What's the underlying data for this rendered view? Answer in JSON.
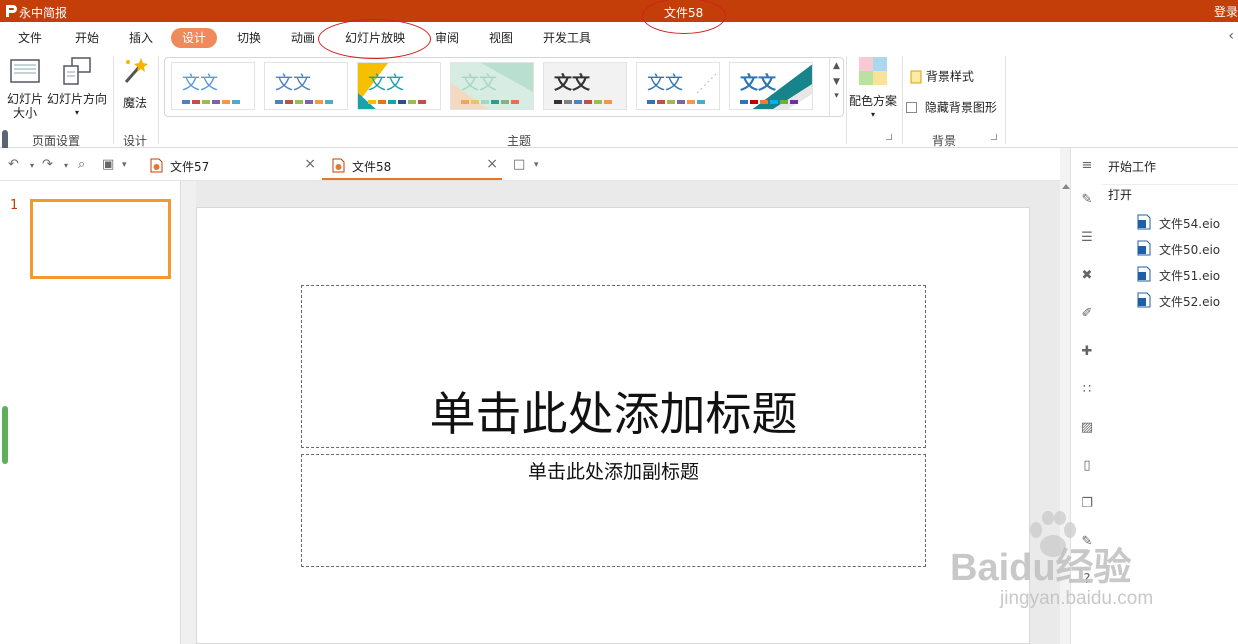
{
  "app": {
    "name": "永中简报",
    "document_title": "文件58",
    "login": "登录"
  },
  "menu": [
    "文件",
    "开始",
    "插入",
    "设计",
    "切换",
    "动画",
    "幻灯片放映",
    "审阅",
    "视图",
    "开发工具"
  ],
  "menu_active": "设计",
  "ribbon": {
    "slide_size": "幻灯片\n大小",
    "slide_orientation": "幻灯片方向",
    "magic": "魔法",
    "group_page_setup": "页面设置",
    "group_design": "设计",
    "group_theme": "主题",
    "color_scheme": "配色方案",
    "background_style": "背景样式",
    "hide_background": "隐藏背景图形",
    "group_background": "背景",
    "theme_glyph": "文文",
    "themes": [
      {
        "first": "#5b9bd5",
        "second": "#5b9bd5",
        "bars": [
          "#4f81bd",
          "#c0504d",
          "#9bbb59",
          "#8064a2",
          "#f79646",
          "#4bacc6"
        ]
      },
      {
        "first": "#4f81bd",
        "second": "#4f81bd",
        "bars": [
          "#4f81bd",
          "#c0504d",
          "#9bbb59",
          "#8064a2",
          "#f79646",
          "#4bacc6"
        ]
      },
      {
        "first": "#1ba2a8",
        "second": "#1ba2a8",
        "bars": [
          "#f6c000",
          "#e3761a",
          "#1ba2a8",
          "#2e4d8a",
          "#9bbb59",
          "#c0504d"
        ]
      },
      {
        "first": "#a8d5c2",
        "second": "#a8d5c2",
        "bars": [
          "#f4a261",
          "#e9c46a",
          "#a8d5c2",
          "#2a9d8f",
          "#8ab17d",
          "#e76f51"
        ]
      },
      {
        "first": "#333333",
        "second": "#555555",
        "bars": [
          "#333333",
          "#7f7f7f",
          "#4f81bd",
          "#c0504d",
          "#9bbb59",
          "#f79646"
        ]
      },
      {
        "first": "#2e75b6",
        "second": "#2e75b6",
        "bars": [
          "#2e75b6",
          "#c0504d",
          "#9bbb59",
          "#8064a2",
          "#f79646",
          "#4bacc6"
        ]
      },
      {
        "first": "#2e75b6",
        "second": "#2e75b6",
        "bars": [
          "#2e75b6",
          "#c00000",
          "#ed7d31",
          "#00b0f0",
          "#70ad47",
          "#7030a0"
        ]
      }
    ]
  },
  "tabs": [
    {
      "label": "文件57",
      "active": false
    },
    {
      "label": "文件58",
      "active": true
    }
  ],
  "thumbnail": {
    "number": "1"
  },
  "slide": {
    "title_placeholder": "单击此处添加标题",
    "subtitle_placeholder": "单击此处添加副标题"
  },
  "taskpane": {
    "header": "开始工作",
    "open_label": "打开",
    "recent_files": [
      "文件54.eio",
      "文件50.eio",
      "文件51.eio",
      "文件52.eio"
    ]
  },
  "watermark": {
    "brand": "Baidu经验",
    "url": "jingyan.baidu.com"
  },
  "colors": {
    "titlebar": "#c43e0a",
    "accent": "#f0895b",
    "thumb_border": "#f39a2d",
    "annotation": "#d41e1e"
  }
}
